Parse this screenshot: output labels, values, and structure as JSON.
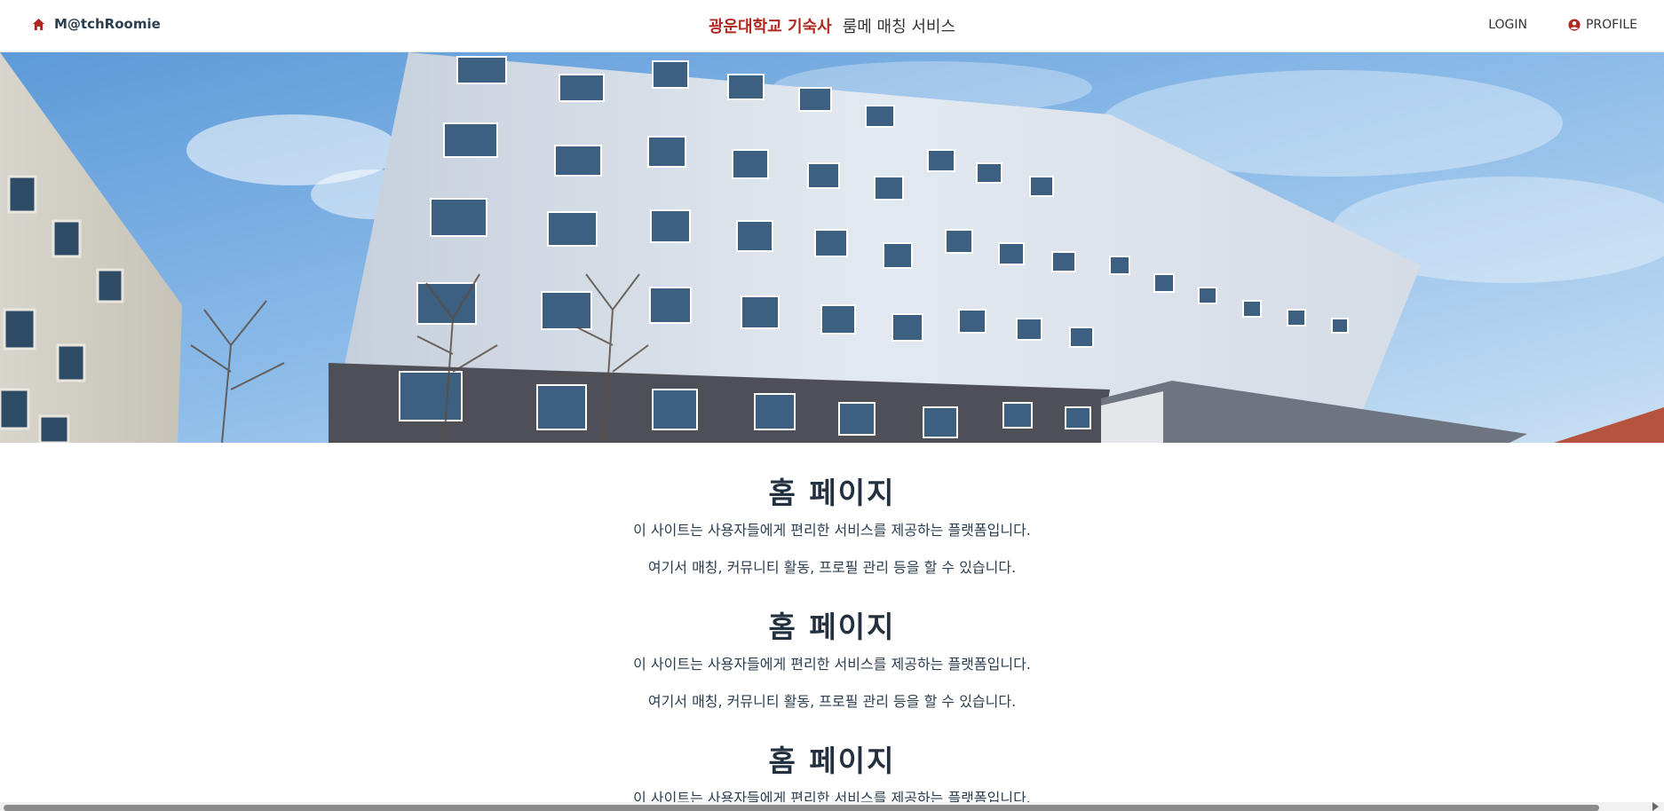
{
  "nav": {
    "brand": "M@tchRoomie",
    "title_university": "광운대학교 기숙사",
    "title_service": "룸메 매칭 서비스",
    "login": "LOGIN",
    "profile": "PROFILE"
  },
  "colors": {
    "accent": "#b0281f",
    "text": "#2c3e50",
    "sky": "#7fb3e6"
  },
  "icons": {
    "brand": "home-icon",
    "profile": "user-circle-icon"
  },
  "sections": [
    {
      "heading": "홈 페이지",
      "line1": "이 사이트는 사용자들에게 편리한 서비스를 제공하는 플랫폼입니다.",
      "line2": "여기서 매칭, 커뮤니티 활동, 프로필 관리 등을 할 수 있습니다."
    },
    {
      "heading": "홈 페이지",
      "line1": "이 사이트는 사용자들에게 편리한 서비스를 제공하는 플랫폼입니다.",
      "line2": "여기서 매칭, 커뮤니티 활동, 프로필 관리 등을 할 수 있습니다."
    },
    {
      "heading": "홈 페이지",
      "line1": "이 사이트는 사용자들에게 편리한 서비스를 제공하는 플랫폼입니다."
    }
  ]
}
